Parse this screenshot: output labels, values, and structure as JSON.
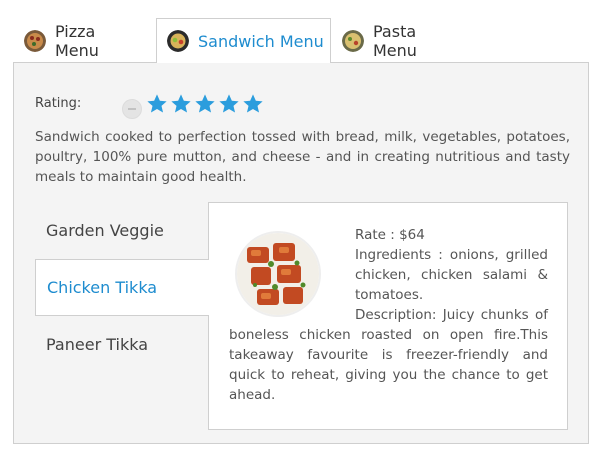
{
  "tabs": [
    {
      "label": "Pizza Menu"
    },
    {
      "label": "Sandwich Menu"
    },
    {
      "label": "Pasta Menu"
    }
  ],
  "rating": {
    "label": "Rating:",
    "value": 5,
    "max": 5
  },
  "colors": {
    "accent": "#1e8ccf",
    "star": "#2b9ddd"
  },
  "description": "Sandwich cooked to perfection tossed with bread, milk, vegetables, potatoes, poultry, 100% pure mutton, and cheese - and in creating nutritious and tasty meals to maintain good health.",
  "items": [
    {
      "label": "Garden Veggie"
    },
    {
      "label": "Chicken Tikka"
    },
    {
      "label": "Paneer Tikka"
    }
  ],
  "detail": {
    "rate": "Rate : $64",
    "ingredients": "Ingredients : onions, grilled chicken, chicken salami & tomatoes.",
    "description": "Description: Juicy chunks of boneless chicken roasted on open fire.This takeaway favourite is freezer-friendly and quick to reheat, giving you the chance to get ahead."
  }
}
